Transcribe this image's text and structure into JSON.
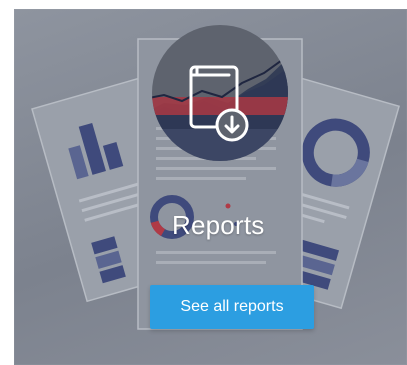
{
  "card": {
    "title": "Reports",
    "button_label": "See all reports",
    "icon": "report-download-icon"
  },
  "colors": {
    "card_background": "#848a95",
    "button": "#2c9ee1",
    "accent_red": "#b03a46",
    "chart_blue": "#3f4a7c"
  }
}
